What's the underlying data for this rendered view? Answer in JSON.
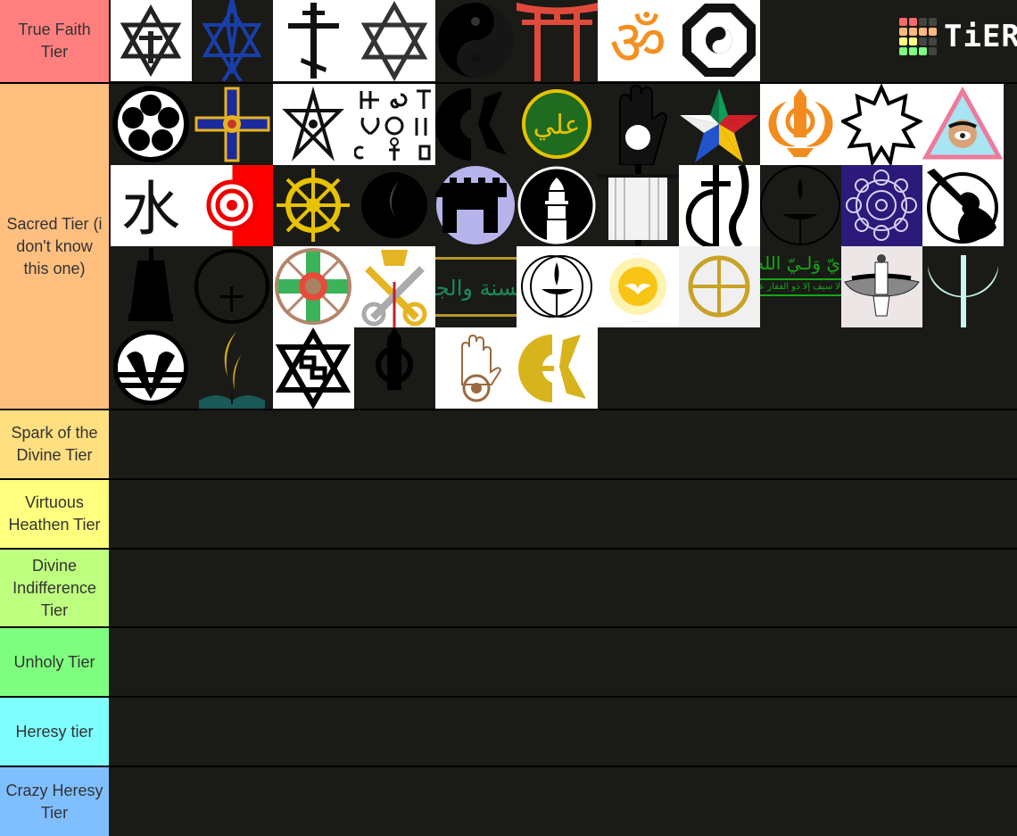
{
  "app": {
    "name": "TierMaker",
    "logo_text": "TiERMAKER"
  },
  "logo_colors": [
    "#f8696b",
    "#f8696b",
    "#444444",
    "#444444",
    "#ffb77b",
    "#ffb77b",
    "#ffb77b",
    "#ffb77b",
    "#ffff7f",
    "#ffff7f",
    "#444444",
    "#444444",
    "#7fff7f",
    "#7fff7f",
    "#7fff7f",
    "#444444"
  ],
  "tiers": [
    {
      "label": "True Faith Tier",
      "color": "#ff7f7f",
      "item_count": 8
    },
    {
      "label": "Sacred Tier (i don't know this one)",
      "color": "#ffbf7f",
      "item_count": 39
    },
    {
      "label": "Spark of the Divine Tier",
      "color": "#ffdf7f",
      "item_count": 0
    },
    {
      "label": "Virtuous Heathen Tier",
      "color": "#ffff7f",
      "item_count": 0
    },
    {
      "label": "Divine Indifference Tier",
      "color": "#bfff7f",
      "item_count": 0
    },
    {
      "label": "Unholy Tier",
      "color": "#7fff7f",
      "item_count": 0
    },
    {
      "label": "Heresy tier",
      "color": "#7fffff",
      "item_count": 0
    },
    {
      "label": "Crazy Heresy Tier",
      "color": "#7fbfff",
      "item_count": 0
    }
  ],
  "items": {
    "true_faith": [
      "star-of-david-with-cross-icon",
      "messianic-star-fish-icon",
      "orthodox-cross-icon",
      "star-of-david-icon",
      "yin-yang-icon",
      "torii-gate-icon",
      "om-symbol-icon",
      "bagua-yin-yang-icon"
    ],
    "sacred_row1": [
      "mon-crest-icon",
      "coptic-cross-icon",
      "unicursal-hexagram-icon",
      "pagan-symbols-grid-icon",
      "eckankar-dark-icon",
      "ali-calligraphy-icon",
      "jain-hand-dark-icon",
      "multicolor-star-icon",
      "khanda-icon",
      "nine-pointed-star-icon",
      "eye-triangle-icon"
    ],
    "sacred_row2": [
      "water-kanji-icon",
      "tenrikyo-emblem-icon",
      "dharma-wheel-icon",
      "adventist-flame-dark-icon",
      "fortress-icon",
      "ahmadiyya-minaret-icon",
      "shroud-cross-icon",
      "cross-flame-icon",
      "chalice-dark-icon",
      "mandala-purple-icon",
      "trumpeter-icon"
    ],
    "sacred_row3": [
      "bell-shrine-icon",
      "circle-cross-dark-icon",
      "rosicrucian-wheel-icon",
      "papal-keys-icon",
      "arabic-calligraphy-banner-icon",
      "chalice-circle-icon",
      "sun-dove-icon",
      "sun-cross-icon",
      "green-arabic-text-icon",
      "faravahar-icon",
      "crescent-trident-icon"
    ],
    "sacred_row4": [
      "ram-horns-circle-icon",
      "adventist-flame-icon",
      "raelian-star-icon",
      "khanda-dark-icon",
      "jain-hand-icon",
      "eckankar-gold-icon"
    ]
  }
}
